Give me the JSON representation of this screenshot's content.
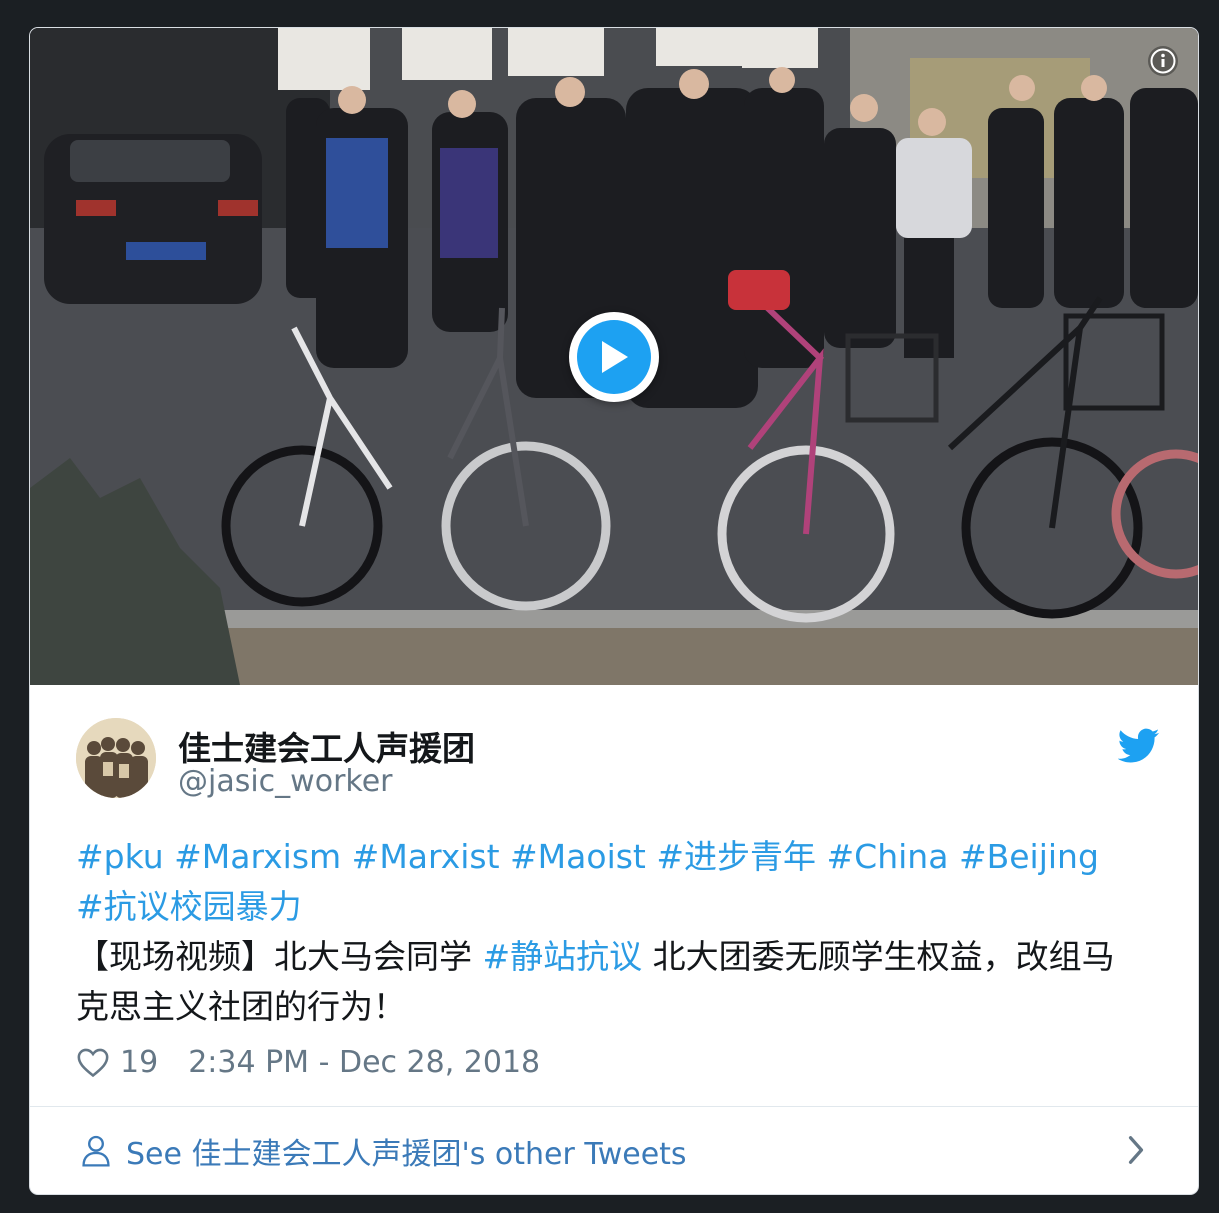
{
  "embed": {
    "author": {
      "display_name": "佳士建会工人声援团",
      "screen_name": "@jasic_worker"
    },
    "tweet": {
      "hashtags_line": [
        {
          "text": "#pku",
          "is_hashtag": true
        },
        {
          "text": "#Marxism",
          "is_hashtag": true
        },
        {
          "text": "#Marxist",
          "is_hashtag": true
        },
        {
          "text": "#Maoist",
          "is_hashtag": true
        },
        {
          "text": "#进步青年",
          "is_hashtag": true
        },
        {
          "text": "#China",
          "is_hashtag": true
        },
        {
          "text": "#Beijing",
          "is_hashtag": true
        },
        {
          "text": "#抗议校园暴力",
          "is_hashtag": true
        }
      ],
      "body_prefix": "【现场视频】北大马会同学 ",
      "body_hashtag": "#静站抗议",
      "body_suffix": " 北大团委无顾学生权益，改组马克思主义社团的行为！"
    },
    "likes": "19",
    "timestamp": "2:34 PM - Dec 28, 2018",
    "footer_label": "See 佳士建会工人声援团's other Tweets",
    "colors": {
      "brand_blue": "#1da1f2",
      "hashtag_blue": "#2b9be4",
      "link_blue": "#3b7ab8",
      "muted_gray": "#657786",
      "text_dark": "#14171a"
    },
    "icons": {
      "info": "info-icon",
      "play": "play-icon",
      "twitter": "twitter-bird-icon",
      "like": "heart-icon",
      "person": "person-icon",
      "chevron": "chevron-right-icon"
    }
  }
}
